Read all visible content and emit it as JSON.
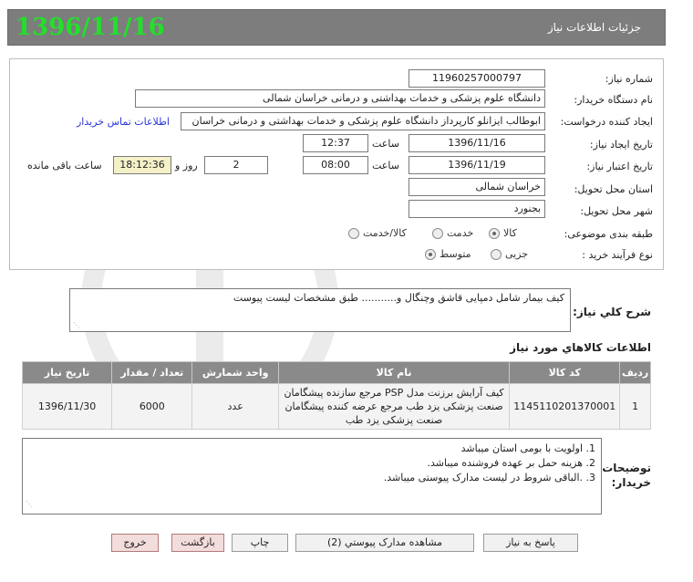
{
  "header": {
    "title": "جزئیات اطلاعات نیاز",
    "date": "1396/11/16"
  },
  "form": {
    "need_number_label": "شماره نیاز:",
    "need_number": "11960257000797",
    "buyer_label": "نام دستگاه خریدار:",
    "buyer": "دانشگاه علوم پزشکی و خدمات بهداشتی و درمانی خراسان شمالی",
    "requester_label": "ایجاد کننده درخواست:",
    "requester": "ابوطالب ایزانلو کارپرداز دانشگاه علوم پزشکی و خدمات بهداشتی و درمانی خراسان",
    "contact_link": "اطلاعات تماس خریدار",
    "created_label": "تاریخ ایجاد نیاز:",
    "created_date": "1396/11/16",
    "time_label": "ساعت",
    "created_time": "12:37",
    "valid_label": "تاریخ اعتبار نیاز:",
    "valid_date": "1396/11/19",
    "valid_time": "08:00",
    "days": "2",
    "days_label": "روز و",
    "remaining_time": "18:12:36",
    "remaining_label": "ساعت باقی مانده",
    "province_label": "استان محل تحویل:",
    "province": "خراسان شمالی",
    "city_label": "شهر محل تحویل:",
    "city": "بجنورد",
    "category_label": "طبقه بندی موضوعی:",
    "category_options": [
      "کالا",
      "خدمت",
      "کالا/خدمت"
    ],
    "category_selected": 0,
    "process_label": "نوع فرآیند خرید :",
    "process_options": [
      "جزیی",
      "متوسط"
    ],
    "process_selected": 1
  },
  "summary": {
    "label": "شرح کلي نياز:",
    "text": "کیف بیمار شامل دمپایی قاشق وچنگال و........... طبق مشخصات لیست پیوست"
  },
  "items": {
    "title": "اطلاعات کالاهاي مورد نياز",
    "columns": [
      "رديف",
      "کد کالا",
      "نام کالا",
      "واحد شمارش",
      "تعداد / مقدار",
      "تاريخ نياز"
    ],
    "rows": [
      {
        "index": "1",
        "code": "1145110201370001",
        "name": "کیف آرایش برزنت مدل PSP مرجع سازنده پیشگامان صنعت پزشکی یزد طب مرجع عرضه کننده پیشگامان صنعت پزشکی یزد طب",
        "unit": "عدد",
        "qty": "6000",
        "date": "1396/11/30"
      }
    ]
  },
  "notes": {
    "label_line1": "توضیحات",
    "label_line2": "خریدار:",
    "lines": [
      "1. اولویت با بومی استان میباشد",
      "2. هزینه حمل بر عهده فروشنده میباشد.",
      "3. .الباقی شروط در لیست مدارک پیوستی میباشد."
    ]
  },
  "buttons": {
    "reply": "پاسخ به نياز",
    "attachments": "مشاهده مدارک پيوستي (2)",
    "print": "چاپ",
    "back": "بازگشت",
    "exit": "خروج"
  }
}
